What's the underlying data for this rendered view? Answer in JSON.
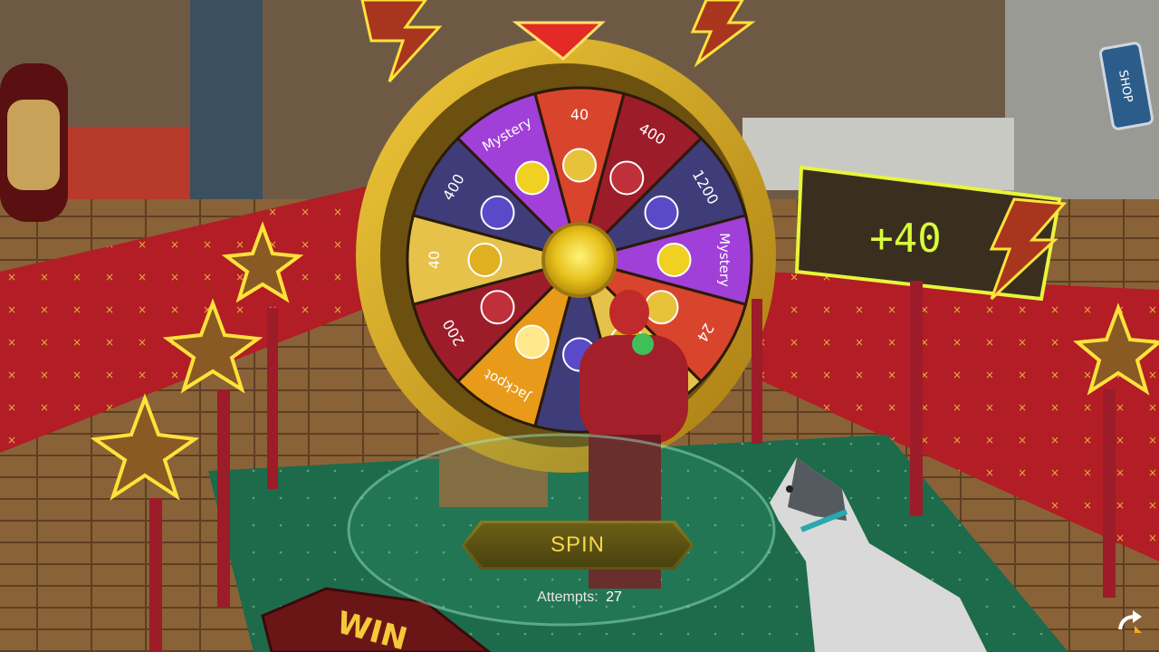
{
  "wheel": {
    "segments": [
      {
        "label": "40",
        "reward": "gold-bars",
        "color": "#d9442c"
      },
      {
        "label": "400",
        "reward": "red-chip",
        "color": "#9c1c2a"
      },
      {
        "label": "1200",
        "reward": "purple-chip",
        "color": "#3f3c7a"
      },
      {
        "label": "Mystery",
        "reward": "mystery-box",
        "color": "#a040d8"
      },
      {
        "label": "24",
        "reward": "gold-case",
        "color": "#d9442c"
      },
      {
        "label": "",
        "reward": "unknown",
        "color": "#e6c24a"
      },
      {
        "label": "",
        "reward": "purple-chip",
        "color": "#3f3c7a"
      },
      {
        "label": "Jackpot",
        "reward": "star",
        "color": "#e89a1a"
      },
      {
        "label": "200",
        "reward": "red-chip",
        "color": "#9c1c2a"
      },
      {
        "label": "40",
        "reward": "gold-coin",
        "color": "#e6c24a"
      },
      {
        "label": "400",
        "reward": "purple-chip",
        "color": "#3f3c7a"
      },
      {
        "label": "Mystery",
        "reward": "mystery-box",
        "color": "#a040d8"
      }
    ]
  },
  "reward_panel": {
    "value": "+40"
  },
  "spin_button": {
    "label": "SPIN"
  },
  "attempts": {
    "label": "Attempts:",
    "count": "27"
  },
  "shop_sign": {
    "label": "SHOP"
  },
  "win_sign": {
    "label": "WIN"
  },
  "colors": {
    "accent_yellow": "#d9ff3a",
    "button_gold": "#f5d84a",
    "carpet_red": "#b21d26",
    "rug_green": "#1d6b4a"
  }
}
